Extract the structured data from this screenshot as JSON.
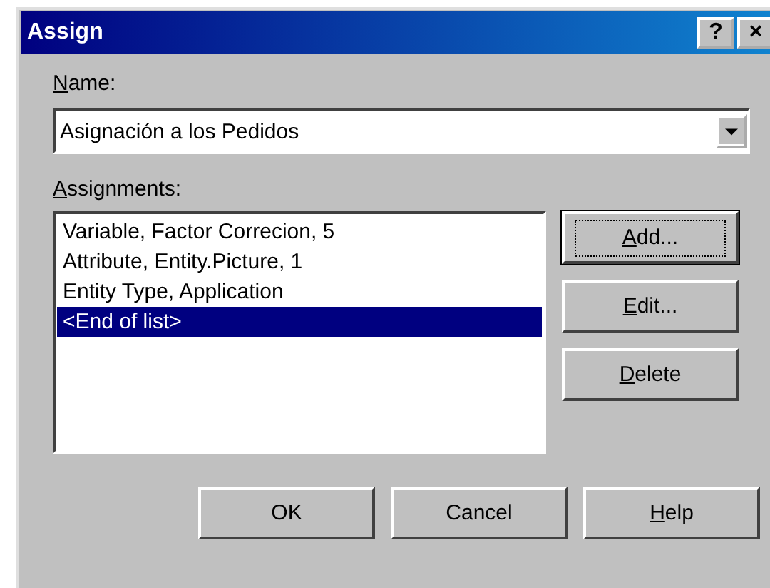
{
  "window": {
    "title": "Assign",
    "title_buttons": [
      "?",
      "×"
    ]
  },
  "name": {
    "label": [
      {
        "text": "N",
        "underlined": true
      },
      {
        "text": "ame:",
        "underlined": false
      }
    ],
    "value": "Asignación a los Pedidos"
  },
  "assignments": {
    "label": [
      {
        "text": "A",
        "underlined": true
      },
      {
        "text": "ssignments:",
        "underlined": false
      }
    ],
    "items": [
      {
        "text": "Variable, Factor Correcion, 5",
        "selected": false
      },
      {
        "text": "Attribute, Entity.Picture, 1",
        "selected": false
      },
      {
        "text": "Entity Type, Application",
        "selected": false
      },
      {
        "text": "<End of list>",
        "selected": true
      }
    ]
  },
  "side_buttons": [
    {
      "label": [
        {
          "text": "A",
          "underlined": true
        },
        {
          "text": "dd...",
          "underlined": false
        }
      ],
      "default": true,
      "focused": true
    },
    {
      "label": [
        {
          "text": "E",
          "underlined": true
        },
        {
          "text": "dit...",
          "underlined": false
        }
      ],
      "default": false,
      "focused": false
    },
    {
      "label": [
        {
          "text": "D",
          "underlined": true
        },
        {
          "text": "elete",
          "underlined": false
        }
      ],
      "default": false,
      "focused": false
    }
  ],
  "buttons": [
    {
      "label": [
        {
          "text": "OK",
          "underlined": false
        }
      ],
      "default": false,
      "focused": false
    },
    {
      "label": [
        {
          "text": "Cancel",
          "underlined": false
        }
      ],
      "default": false,
      "focused": false
    },
    {
      "label": [
        {
          "text": "H",
          "underlined": true
        },
        {
          "text": "elp",
          "underlined": false
        }
      ],
      "default": false,
      "focused": false
    }
  ]
}
